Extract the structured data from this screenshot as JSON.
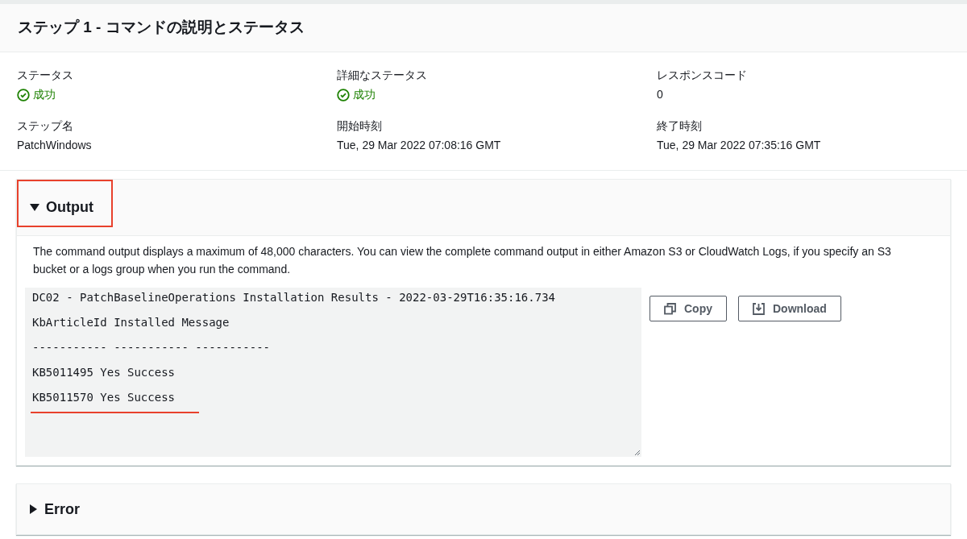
{
  "header": {
    "title": "ステップ 1 - コマンドの説明とステータス"
  },
  "details": [
    {
      "label": "ステータス",
      "value": "成功",
      "kind": "status"
    },
    {
      "label": "詳細なステータス",
      "value": "成功",
      "kind": "status"
    },
    {
      "label": "レスポンスコード",
      "value": "0",
      "kind": "text"
    },
    {
      "label": "ステップ名",
      "value": "PatchWindows",
      "kind": "text"
    },
    {
      "label": "開始時刻",
      "value": "Tue, 29 Mar 2022 07:08:16 GMT",
      "kind": "text"
    },
    {
      "label": "終了時刻",
      "value": "Tue, 29 Mar 2022 07:35:16 GMT",
      "kind": "text"
    }
  ],
  "sections": [
    {
      "title": "Output",
      "expanded": true,
      "highlighted": true,
      "description": "The command output displays a maximum of 48,000 characters. You can view the complete command output in either Amazon S3 or CloudWatch Logs, if you specify an S3 bucket or a logs group when you run the command.",
      "output_lines": [
        {
          "text": "DC02 - PatchBaselineOperations Installation Results - 2022-03-29T16:35:16.734",
          "underlined": false
        },
        {
          "text": "KbArticleId Installed Message",
          "underlined": false
        },
        {
          "text": "----------- ----------- -----------",
          "underlined": false
        },
        {
          "text": "KB5011495 Yes Success",
          "underlined": false
        },
        {
          "text": "KB5011570 Yes Success",
          "underlined": true
        }
      ],
      "buttons": [
        {
          "label": "Copy",
          "kind": "copy"
        },
        {
          "label": "Download",
          "kind": "download"
        }
      ]
    },
    {
      "title": "Error",
      "expanded": false,
      "highlighted": false
    }
  ]
}
